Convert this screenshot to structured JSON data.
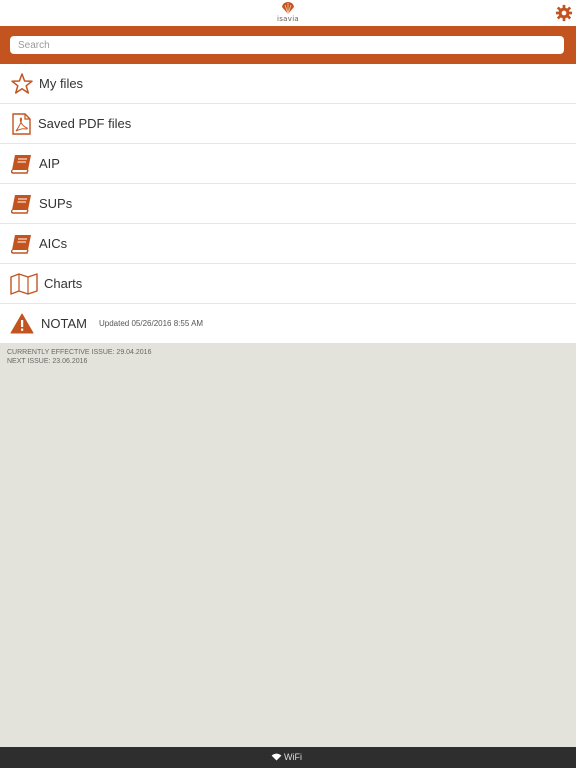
{
  "header": {
    "logo_icon": "isavia-shell-logo",
    "logo_text": "isavia",
    "settings_icon": "gear-icon"
  },
  "search": {
    "placeholder": "Search",
    "value": ""
  },
  "menu": {
    "items": [
      {
        "label": "My files",
        "icon": "star-icon"
      },
      {
        "label": "Saved PDF files",
        "icon": "pdf-icon"
      },
      {
        "label": "AIP",
        "icon": "book-icon"
      },
      {
        "label": "SUPs",
        "icon": "book-icon"
      },
      {
        "label": "AICs",
        "icon": "book-icon"
      },
      {
        "label": "Charts",
        "icon": "map-icon"
      },
      {
        "label": "NOTAM",
        "icon": "warning-icon",
        "updated": "Updated 05/26/2016 8:55 AM"
      }
    ]
  },
  "issue": {
    "current": "CURRENTLY EFFECTIVE ISSUE: 29.04.2016",
    "next": "NEXT ISSUE: 23.06.2016"
  },
  "status_bar": {
    "wifi_label": "WiFi"
  },
  "colors": {
    "accent": "#c35420",
    "background": "#e4e3db",
    "status_bar": "#2e2e2e"
  }
}
